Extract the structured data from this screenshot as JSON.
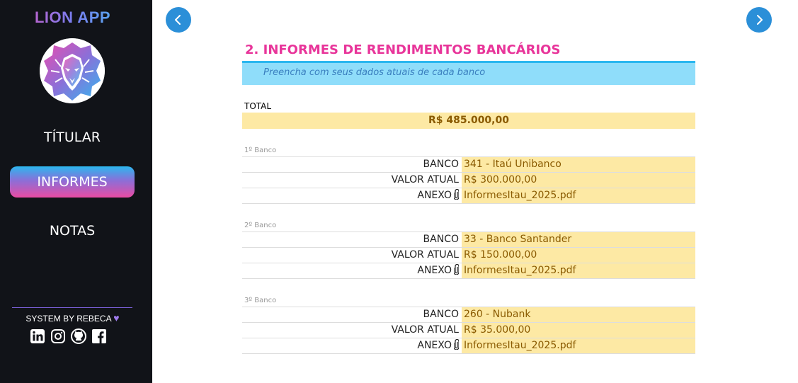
{
  "app": {
    "title": "LION APP"
  },
  "sidebar": {
    "items": [
      {
        "label": "TÍTULAR"
      },
      {
        "label": "INFORMES",
        "active": true
      },
      {
        "label": "NOTAS"
      }
    ],
    "credit": "SYSTEM BY REBECA",
    "socials": [
      "linkedin-icon",
      "instagram-icon",
      "github-icon",
      "facebook-icon"
    ]
  },
  "main": {
    "title": "2. INFORMES DE RENDIMENTOS BANCÁRIOS",
    "subtitle": "Preencha com seus dados atuais de cada banco",
    "total_label": "TOTAL",
    "total_value": "R$ 485.000,00",
    "banks": [
      {
        "heading": "1º Banco",
        "banco_label": "BANCO",
        "banco": "341 - Itaú Unibanco",
        "valor_label": "VALOR ATUAL",
        "valor": "R$ 300.000,00",
        "anexo_label": "ANEXO",
        "anexo": "InformesItau_2025.pdf"
      },
      {
        "heading": "2º Banco",
        "banco_label": "BANCO",
        "banco": "33 - Banco Santander",
        "valor_label": "VALOR ATUAL",
        "valor": "R$ 150.000,00",
        "anexo_label": "ANEXO",
        "anexo": "InformesItau_2025.pdf"
      },
      {
        "heading": "3º Banco",
        "banco_label": "BANCO",
        "banco": "260 - Nubank",
        "valor_label": "VALOR ATUAL",
        "valor": "R$ 35.000,00",
        "anexo_label": "ANEXO",
        "anexo": "InformesItau_2025.pdf"
      }
    ]
  },
  "colors": {
    "sidebar_bg": "#111318",
    "accent_pink": "#e8359a",
    "accent_blue": "#2bb7ef",
    "field_bg": "#fde9a4",
    "field_text": "#8a5a00"
  }
}
